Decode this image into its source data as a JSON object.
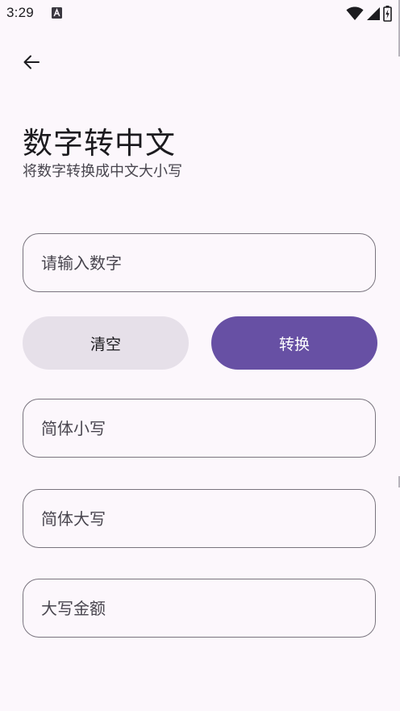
{
  "status_bar": {
    "time": "3:29"
  },
  "header": {
    "title": "数字转中文",
    "subtitle": "将数字转换成中文大小写"
  },
  "input": {
    "placeholder": "请输入数字",
    "value": ""
  },
  "buttons": {
    "clear_label": "清空",
    "convert_label": "转换"
  },
  "outputs": [
    {
      "placeholder": "简体小写",
      "value": ""
    },
    {
      "placeholder": "简体大写",
      "value": ""
    },
    {
      "placeholder": "大写金额",
      "value": ""
    }
  ],
  "colors": {
    "background": "#FCF7FC",
    "primary": "#6750A4",
    "secondary_container": "#E6E0E9",
    "outline": "#79747E",
    "on_surface": "#1C1B1F",
    "on_surface_variant": "#48454E"
  },
  "icons": {
    "back": "arrow-back-icon",
    "notification": "a-letter-notification-icon",
    "wifi": "wifi-icon",
    "signal": "cell-signal-icon",
    "battery": "battery-charging-icon"
  }
}
